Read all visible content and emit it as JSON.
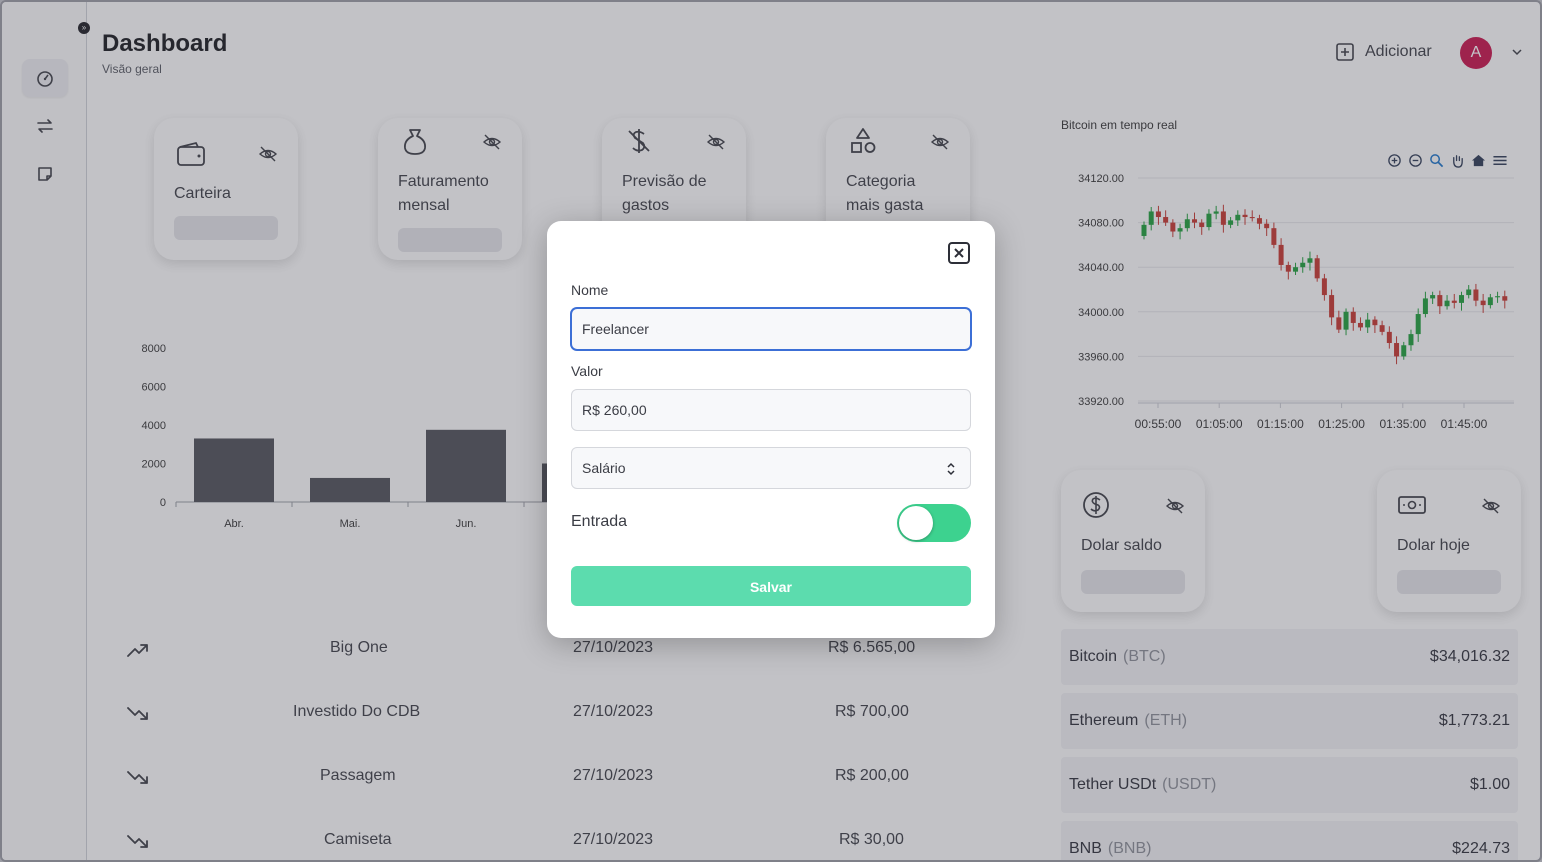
{
  "header": {
    "title": "Dashboard",
    "subtitle": "Visão geral",
    "add_label": "Adicionar",
    "avatar_initial": "A"
  },
  "cards": [
    {
      "label": "Carteira"
    },
    {
      "label1": "Faturamento",
      "label2": "mensal"
    },
    {
      "label1": "Previsão de",
      "label2": "gastos"
    },
    {
      "label1": "Categoria",
      "label2": "mais gasta"
    }
  ],
  "dollar_cards": [
    {
      "label": "Dolar saldo"
    },
    {
      "label": "Dolar hoje"
    }
  ],
  "chart_data": [
    {
      "type": "bar",
      "categories": [
        "Abr.",
        "Mai.",
        "Jun.",
        ""
      ],
      "values": [
        3300,
        1250,
        3750,
        2000
      ],
      "ylim": [
        0,
        8000
      ],
      "yticks": [
        "8000",
        "6000",
        "4000",
        "2000",
        "0"
      ],
      "color": "#4f5058"
    },
    {
      "type": "candlestick",
      "title": "Bitcoin em tempo real",
      "xticks": [
        "00:55:00",
        "01:05:00",
        "01:15:00",
        "01:25:00",
        "01:35:00",
        "01:45:00"
      ],
      "yticks": [
        "34120.00",
        "34080.00",
        "34040.00",
        "34000.00",
        "33960.00",
        "33920.00"
      ],
      "ylim": [
        33920,
        34120
      ],
      "up_color": "#1e9e3a",
      "down_color": "#c6362f",
      "closes": [
        34078,
        34090,
        34085,
        34080,
        34072,
        34075,
        34083,
        34080,
        34076,
        34088,
        34090,
        34078,
        34082,
        34087,
        34085,
        34084,
        34079,
        34075,
        34060,
        34042,
        34036,
        34040,
        34044,
        34048,
        34030,
        34015,
        33995,
        33984,
        34000,
        33990,
        33986,
        33993,
        33988,
        33982,
        33972,
        33960,
        33970,
        33980,
        33998,
        34012,
        34015,
        34005,
        34010,
        34008,
        34015,
        34020,
        34010,
        34006,
        34013,
        34014,
        34010
      ]
    }
  ],
  "transactions": [
    {
      "name": "Big One",
      "date": "27/10/2023",
      "value": "R$ 6.565,00",
      "dir": "up"
    },
    {
      "name": "Investido Do CDB",
      "date": "27/10/2023",
      "value": "R$ 700,00",
      "dir": "down"
    },
    {
      "name": "Passagem",
      "date": "27/10/2023",
      "value": "R$ 200,00",
      "dir": "down"
    },
    {
      "name": "Camiseta",
      "date": "27/10/2023",
      "value": "R$ 30,00",
      "dir": "down"
    }
  ],
  "crypto": [
    {
      "name": "Bitcoin",
      "symbol": "(BTC)",
      "price": "$34,016.32"
    },
    {
      "name": "Ethereum",
      "symbol": "(ETH)",
      "price": "$1,773.21"
    },
    {
      "name": "Tether USDt",
      "symbol": "(USDT)",
      "price": "$1.00"
    },
    {
      "name": "BNB",
      "symbol": "(BNB)",
      "price": "$224.73"
    }
  ],
  "modal": {
    "name_label": "Nome",
    "name_value": "Freelancer",
    "value_label": "Valor",
    "value_value": "R$ 260,00",
    "category_value": "Salário",
    "switch_label": "Entrada",
    "switch_on": true,
    "save_label": "Salvar"
  },
  "icons": {
    "sidebar": [
      "dashboard-icon",
      "transfer-icon",
      "note-icon"
    ],
    "accent": "#3dd28f"
  }
}
